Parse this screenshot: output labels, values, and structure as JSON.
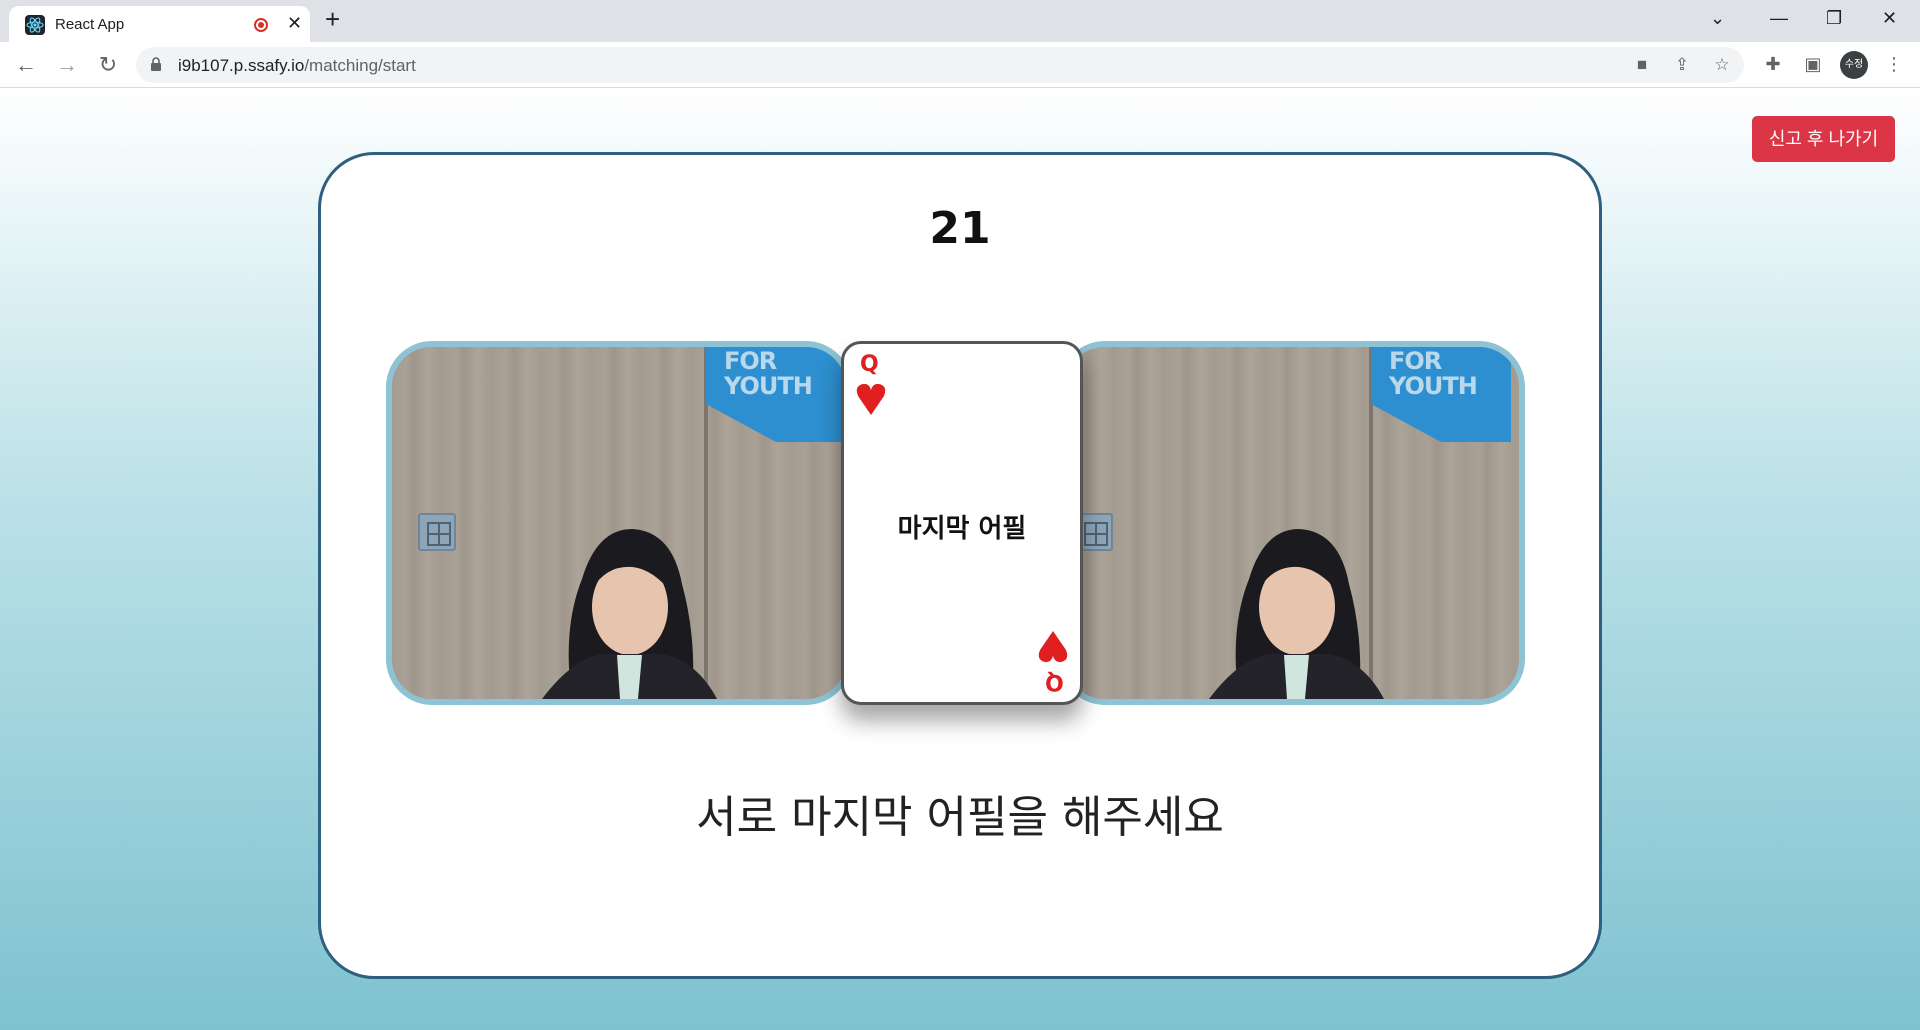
{
  "browser": {
    "tab_title": "React App",
    "url_host": "i9b107.p.ssafy.io",
    "url_path": "/matching/start",
    "profile_initials": "수정"
  },
  "page": {
    "report_button": "신고 후 나가기",
    "countdown": "21",
    "card": {
      "rank": "Q",
      "suit": "heart",
      "suit_color": "#e02020",
      "text": "마지막 어필"
    },
    "video_left": {
      "banner_line1": "FOR",
      "banner_line2": "YOUTH"
    },
    "video_right": {
      "banner_line1": "FOR",
      "banner_line2": "YOUTH"
    },
    "instruction": "서로 마지막 어필을 해주세요"
  }
}
